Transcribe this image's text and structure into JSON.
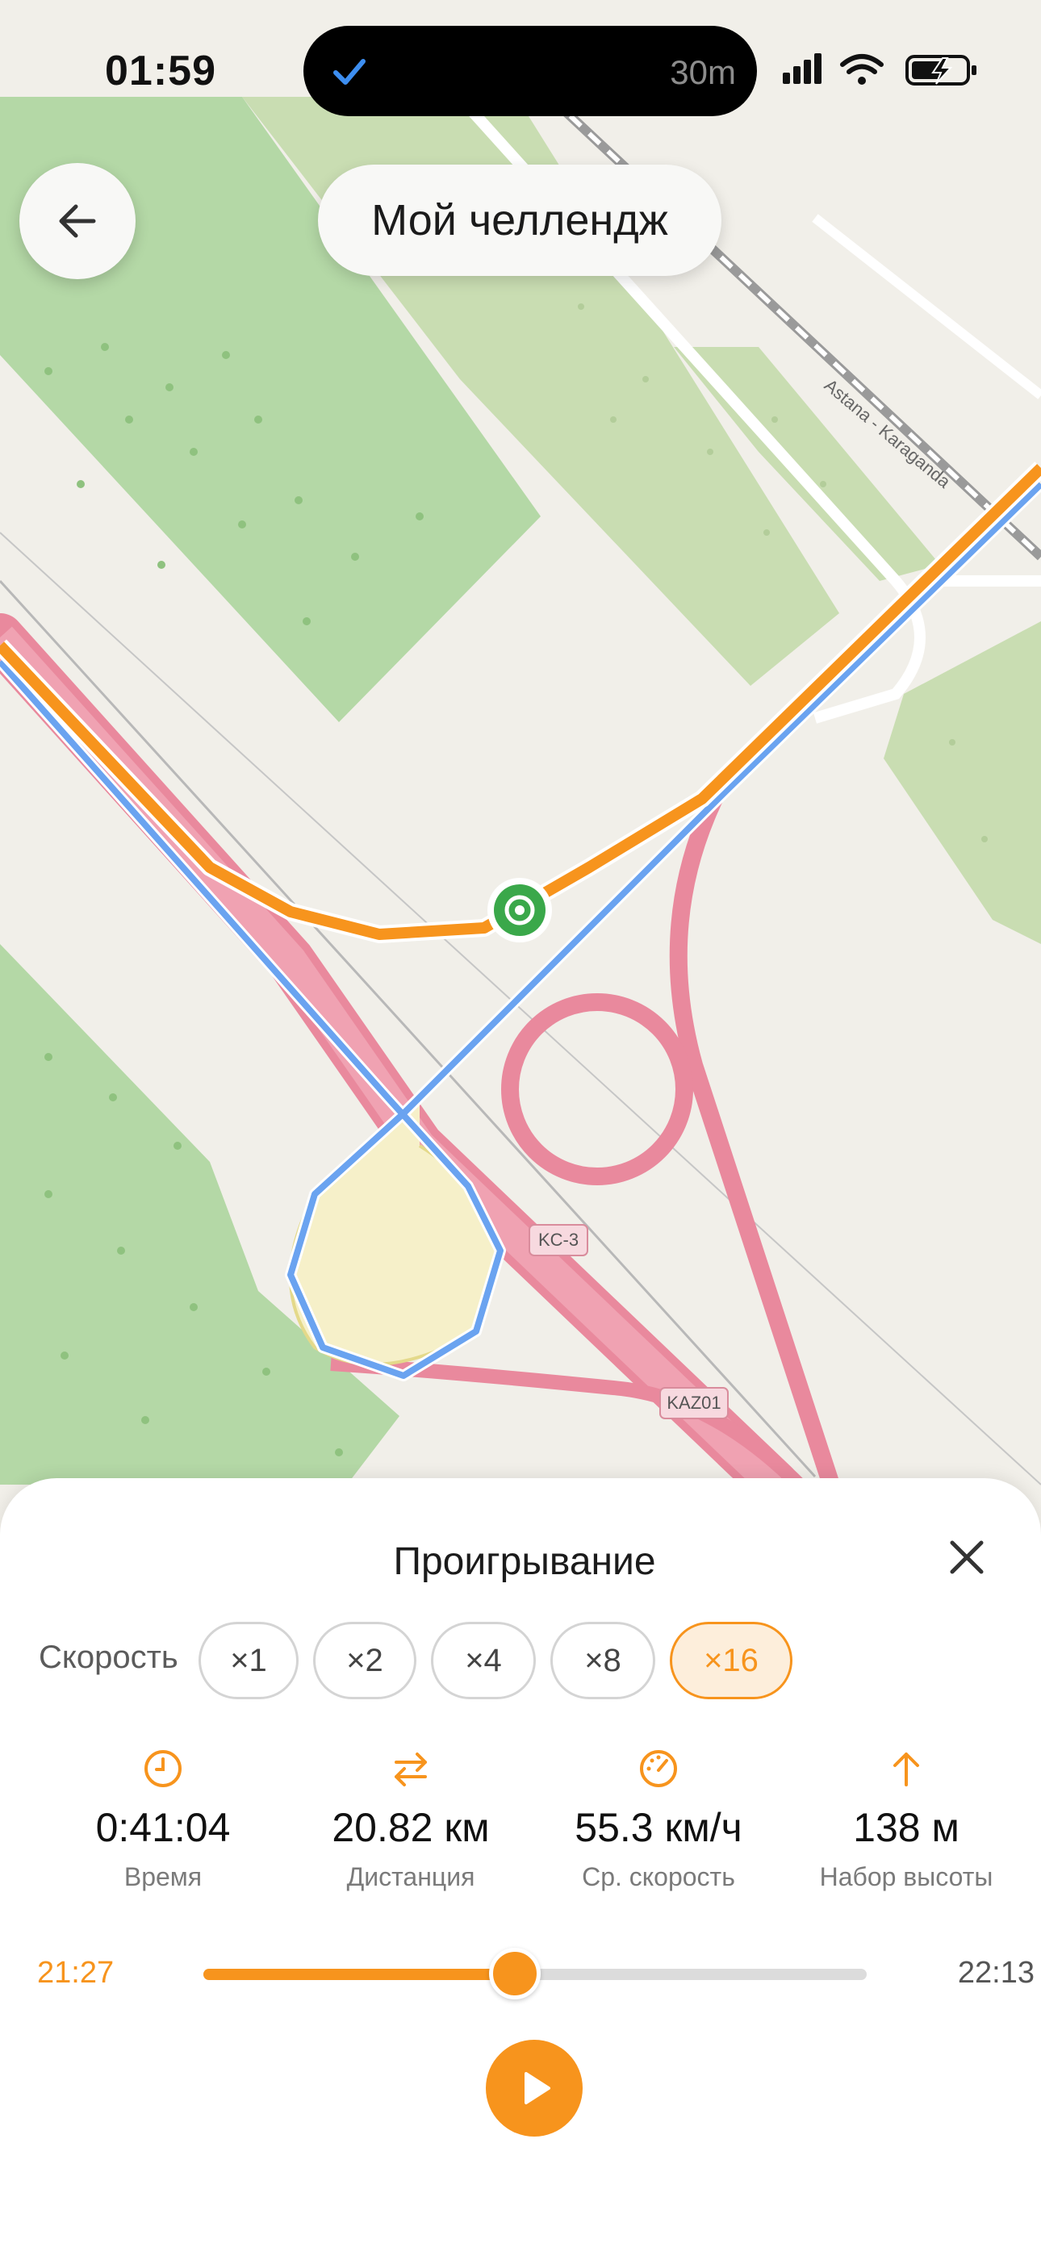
{
  "status_bar": {
    "time": "01:59",
    "island_duration": "30m"
  },
  "map": {
    "road_labels": [
      "KC-3",
      "KAZ01"
    ],
    "railway_label": "Astana - Karaganda",
    "route_color": "#f7941d",
    "track_color": "#6aa3f0",
    "road_color": "#e9899d"
  },
  "header": {
    "title": "Мой челлендж"
  },
  "playback": {
    "title": "Проигрывание",
    "speed_label": "Скорость",
    "speeds": [
      "×1",
      "×2",
      "×4",
      "×8",
      "×16"
    ],
    "active_speed": "×16",
    "stats": [
      {
        "icon": "clock-icon",
        "value": "0:41:04",
        "label": "Время"
      },
      {
        "icon": "distance-arrows-icon",
        "value": "20.82 км",
        "label": "Дистанция"
      },
      {
        "icon": "speedometer-icon",
        "value": "55.3 км/ч",
        "label": "Ср. скорость"
      },
      {
        "icon": "arrow-up-icon",
        "value": "138 м",
        "label": "Набор высоты"
      }
    ],
    "time_start": "21:27",
    "time_end": "22:13",
    "progress_fraction": 0.47,
    "accent_color": "#f7941d"
  }
}
